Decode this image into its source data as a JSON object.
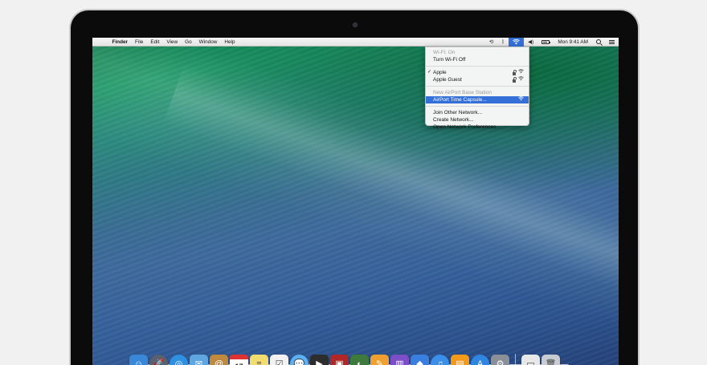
{
  "menubar": {
    "apple_glyph": "",
    "app_name": "Finder",
    "menus": [
      "File",
      "Edit",
      "View",
      "Go",
      "Window",
      "Help"
    ],
    "clock": "Mon 9:41 AM",
    "status_icons": {
      "time_machine": "time-machine-icon",
      "bluetooth": "bluetooth-icon",
      "wifi": "wifi-icon",
      "volume": "volume-icon",
      "battery": "battery-icon",
      "spotlight": "spotlight-icon",
      "notifications": "notification-center-icon"
    }
  },
  "wifi_menu": {
    "status": "Wi-Fi: On",
    "toggle": "Turn Wi-Fi Off",
    "networks": [
      {
        "name": "Apple",
        "checked": true,
        "locked": true
      },
      {
        "name": "Apple Guest",
        "checked": false,
        "locked": true
      }
    ],
    "base_station_header": "New AirPort Base Station",
    "base_station_item": "AirPort Time Capsule...",
    "actions": [
      "Join Other Network...",
      "Create Network...",
      "Open Network Preferences..."
    ]
  },
  "dock": {
    "apps": [
      {
        "name": "finder-icon",
        "glyph": "☺",
        "color": "#3a86d8"
      },
      {
        "name": "launchpad-icon",
        "glyph": "🚀",
        "color": "#5a6070"
      },
      {
        "name": "safari-icon",
        "glyph": "◎",
        "color": "#2f8fe0"
      },
      {
        "name": "mail-icon",
        "glyph": "✉",
        "color": "#5fa6e0"
      },
      {
        "name": "contacts-icon",
        "glyph": "@",
        "color": "#c08a3e"
      },
      {
        "name": "calendar-icon",
        "glyph": "17",
        "color": "#ffffff"
      },
      {
        "name": "notes-icon",
        "glyph": "≡",
        "color": "#f3dc6e"
      },
      {
        "name": "reminders-icon",
        "glyph": "☑",
        "color": "#f2f2f2"
      },
      {
        "name": "messages-icon",
        "glyph": "💬",
        "color": "#5ab0f0"
      },
      {
        "name": "facetime-icon",
        "glyph": "▶",
        "color": "#2d2d2d"
      },
      {
        "name": "photo-booth-icon",
        "glyph": "▣",
        "color": "#b12626"
      },
      {
        "name": "iphoto-icon",
        "glyph": "◐",
        "color": "#3d7a3b"
      },
      {
        "name": "pages-icon",
        "glyph": "✎",
        "color": "#f0a030"
      },
      {
        "name": "numbers-icon",
        "glyph": "▥",
        "color": "#7c4fc9"
      },
      {
        "name": "keynote-icon",
        "glyph": "◆",
        "color": "#3a7ee0"
      },
      {
        "name": "itunes-icon",
        "glyph": "♫",
        "color": "#3b8fe8"
      },
      {
        "name": "ibooks-icon",
        "glyph": "▤",
        "color": "#f39a1a"
      },
      {
        "name": "app-store-icon",
        "glyph": "A",
        "color": "#2f86e0"
      },
      {
        "name": "system-preferences-icon",
        "glyph": "⚙",
        "color": "#8a8f98"
      }
    ],
    "stacks": [
      {
        "name": "downloads-stack-icon",
        "glyph": "▭",
        "color": "#e8e8e8"
      },
      {
        "name": "trash-icon",
        "glyph": "🗑",
        "color": "#c8ccd2"
      }
    ]
  }
}
